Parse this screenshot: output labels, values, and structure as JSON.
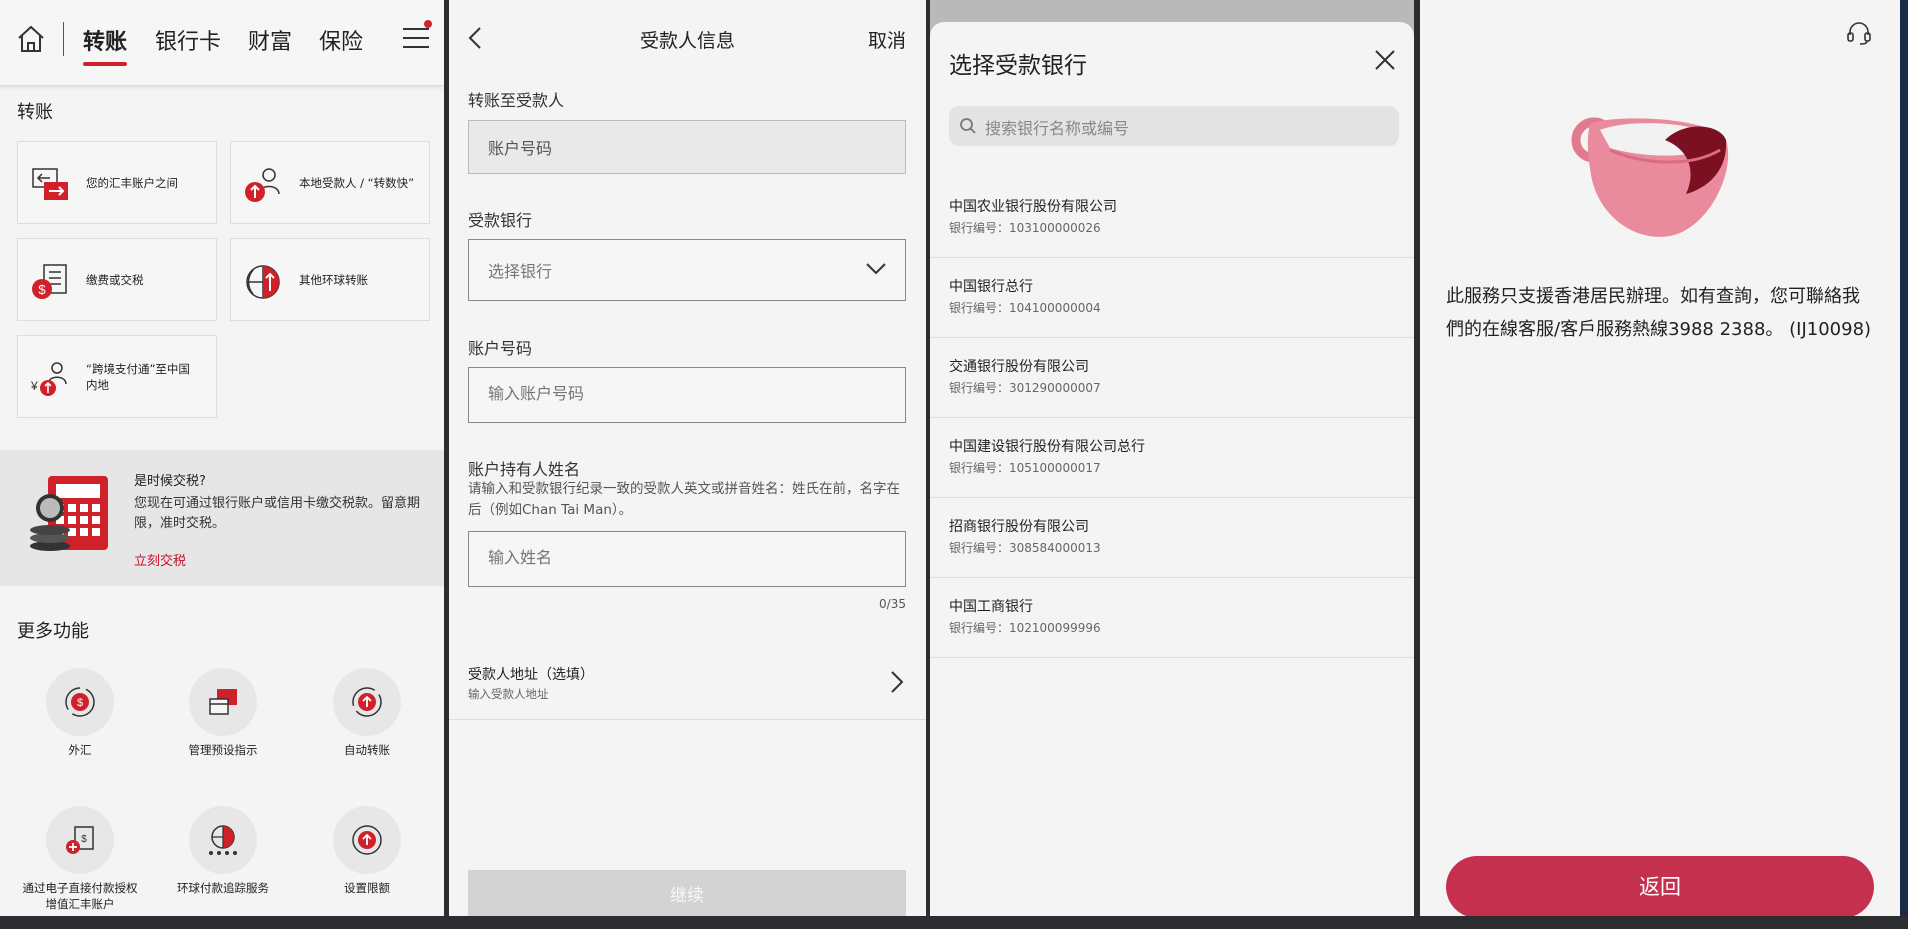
{
  "panel1": {
    "nav": {
      "tabs": [
        "转账",
        "银行卡",
        "财富",
        "保险"
      ]
    },
    "section_title": "转账",
    "tiles": [
      {
        "label": "您的汇丰账户之间"
      },
      {
        "label": "本地受款人 / “转数快”"
      },
      {
        "label": "缴费或交税"
      },
      {
        "label": "其他环球转账"
      },
      {
        "label_line1": "“跨境支付通”至中国",
        "label_line2": "内地"
      }
    ],
    "tax_banner": {
      "title": "是时候交税?",
      "desc": "您现在可通过银行账户或信用卡缴交税款。留意期限，准时交税。",
      "link": "立刻交税"
    },
    "more_title": "更多功能",
    "features": [
      {
        "label": "外汇"
      },
      {
        "label": "管理预设指示"
      },
      {
        "label": "自动转账"
      },
      {
        "label_line1": "通过电子直接付款授权",
        "label_line2": "增值汇丰账户"
      },
      {
        "label": "环球付款追踪服务"
      },
      {
        "label": "设置限额"
      }
    ]
  },
  "panel2": {
    "title": "受款人信息",
    "cancel": "取消",
    "transfer_to_label": "转账至受款人",
    "transfer_to_value": "账户号码",
    "bank_label": "受款银行",
    "bank_placeholder": "选择银行",
    "account_label": "账户号码",
    "account_placeholder": "输入账户号码",
    "holder_label": "账户持有人姓名",
    "holder_hint": "请输入和受款银行纪录一致的受款人英文或拼音姓名：姓氏在前，名字在后（例如Chan Tai Man）。",
    "holder_placeholder": "输入姓名",
    "char_count": "0/35",
    "address_title": "受款人地址（选填）",
    "address_sub": "输入受款人地址",
    "continue": "继续"
  },
  "panel3": {
    "title": "选择受款银行",
    "search_placeholder": "搜索银行名称或编号",
    "banks": [
      {
        "name": "中国农业银行股份有限公司",
        "code": "银行编号：103100000026"
      },
      {
        "name": "中国银行总行",
        "code": "银行编号：104100000004"
      },
      {
        "name": "交通银行股份有限公司",
        "code": "银行编号：301290000007"
      },
      {
        "name": "中国建设银行股份有限公司总行",
        "code": "银行编号：105100000017"
      },
      {
        "name": "招商银行股份有限公司",
        "code": "银行编号：308584000013"
      },
      {
        "name": "中国工商银行",
        "code": "银行编号：102100099996"
      }
    ]
  },
  "panel4": {
    "message": "此服務只支援香港居民辦理。如有查詢，您可聯絡我們的在線客服/客戶服務熱線3988 2388。 (IJ10098)",
    "return": "返回"
  },
  "colors": {
    "brand_red": "#d0212a",
    "return_button": "#c6304f",
    "continue_disabled": "#d3d3d3"
  }
}
